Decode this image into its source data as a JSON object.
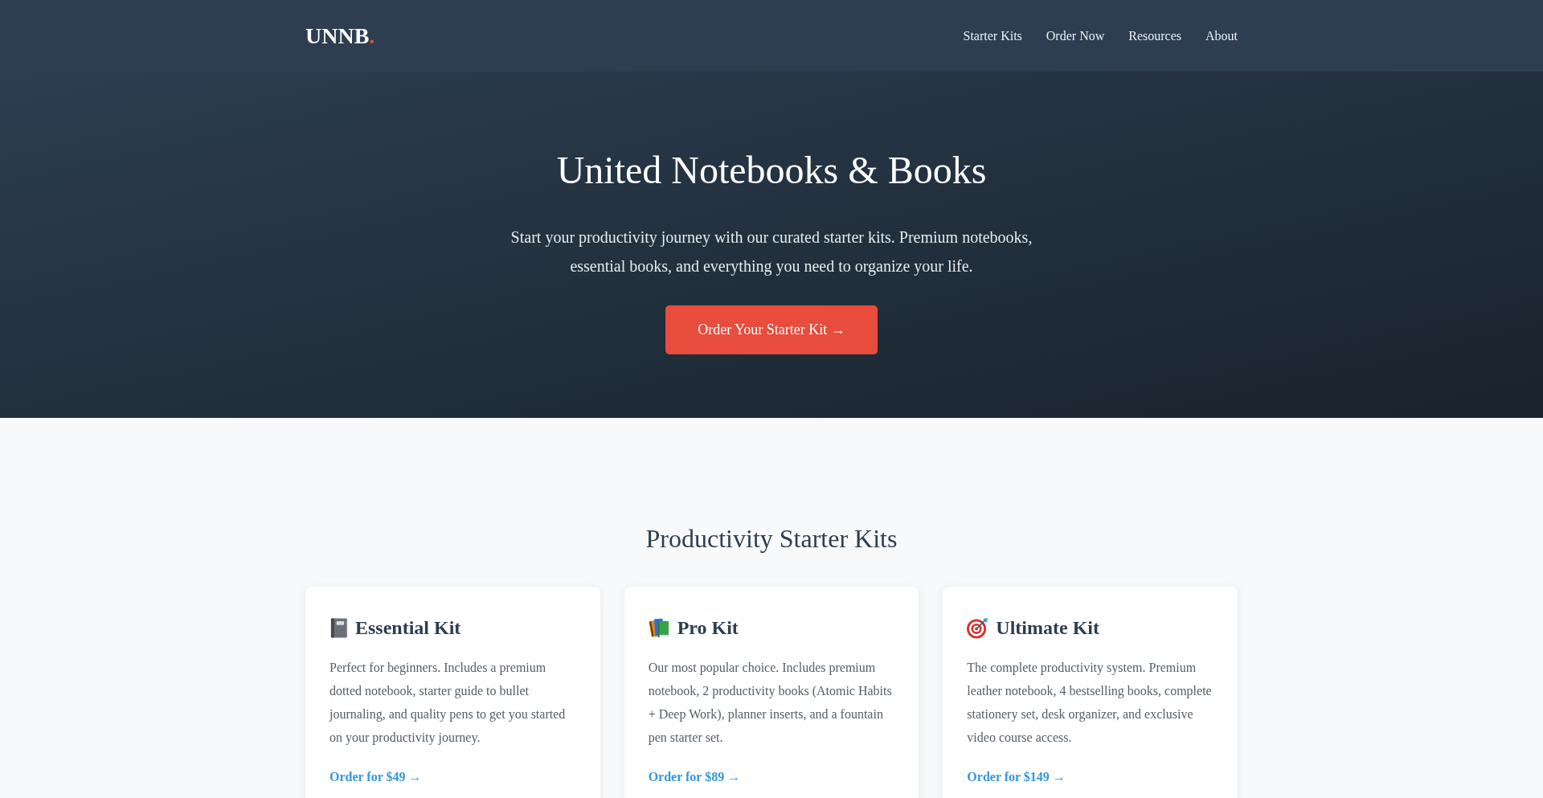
{
  "header": {
    "logo": {
      "text": "UNNB",
      "accent": "."
    },
    "nav": [
      "Starter Kits",
      "Order Now",
      "Resources",
      "About"
    ]
  },
  "hero": {
    "title": "United Notebooks & Books",
    "subtitle": "Start your productivity journey with our curated starter kits. Premium notebooks, essential books, and everything you need to organize your life.",
    "cta": "Order Your Starter Kit →"
  },
  "kits_section": {
    "heading": "Productivity Starter Kits",
    "cards": [
      {
        "title": "Essential Kit",
        "description": "Perfect for beginners. Includes a premium dotted notebook, starter guide to bullet journaling, and quality pens to get you started on your productivity journey.",
        "link": "Order for $49 →"
      },
      {
        "title": "Pro Kit",
        "description": "Our most popular choice. Includes premium notebook, 2 productivity books (Atomic Habits + Deep Work), planner inserts, and a fountain pen starter set.",
        "link": "Order for $89 →"
      },
      {
        "title": "Ultimate Kit",
        "description": "The complete productivity system. Premium leather notebook, 4 bestselling books, complete stationery set, desk organizer, and exclusive video course access.",
        "link": "Order for $149 →"
      }
    ]
  }
}
